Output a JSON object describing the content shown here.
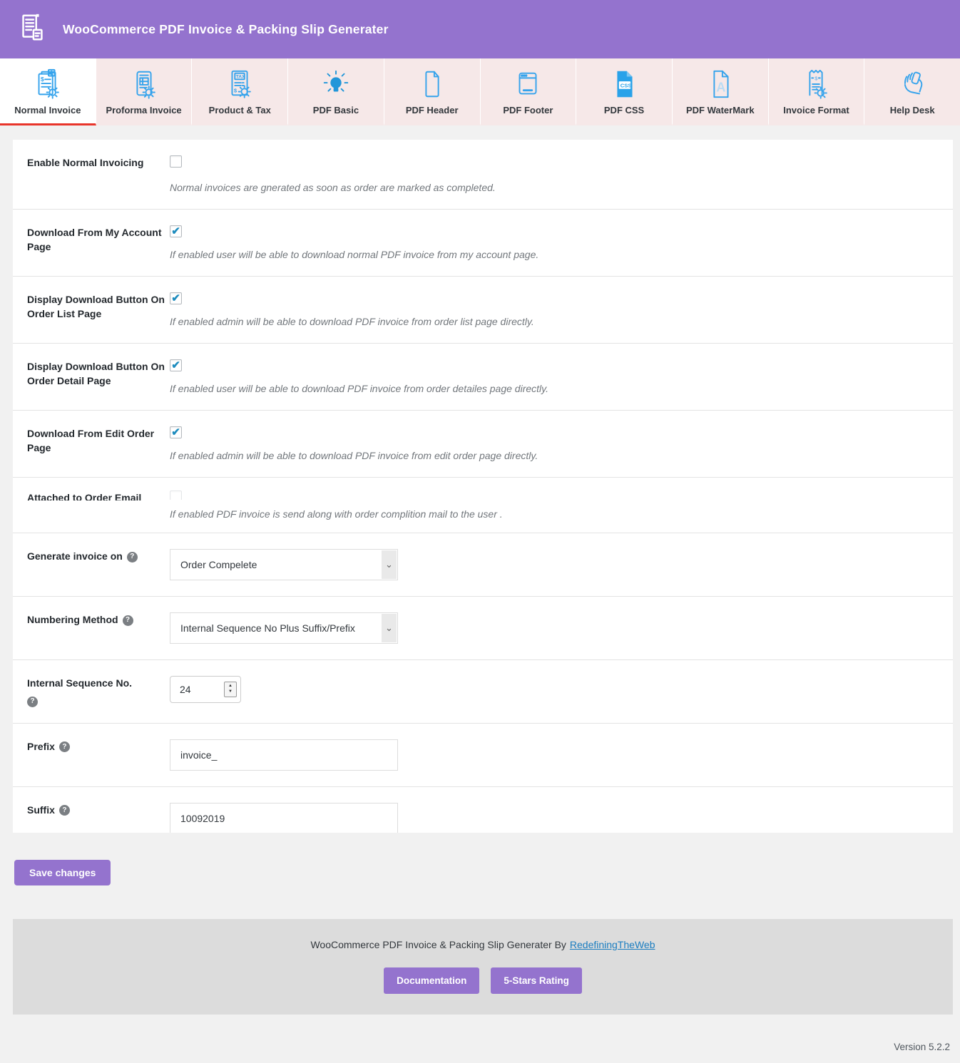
{
  "header": {
    "title": "WooCommerce PDF Invoice & Packing Slip Generater"
  },
  "tabs": [
    {
      "label": "Normal Invoice",
      "active": true
    },
    {
      "label": "Proforma Invoice",
      "active": false
    },
    {
      "label": "Product & Tax",
      "active": false
    },
    {
      "label": "PDF Basic",
      "active": false
    },
    {
      "label": "PDF Header",
      "active": false
    },
    {
      "label": "PDF Footer",
      "active": false
    },
    {
      "label": "PDF CSS",
      "active": false
    },
    {
      "label": "PDF WaterMark",
      "active": false
    },
    {
      "label": "Invoice Format",
      "active": false
    },
    {
      "label": "Help Desk",
      "active": false
    }
  ],
  "settings": {
    "rows": [
      {
        "label": "Enable Normal Invoicing",
        "control": "checkbox",
        "checked": false,
        "description": "Normal invoices are gnerated as soon as order are marked as completed."
      },
      {
        "label": "Download From My Account Page",
        "control": "checkbox",
        "checked": true,
        "description": "If enabled user will be able to download normal PDF invoice from my account page."
      },
      {
        "label": "Display Download Button On Order List Page",
        "control": "checkbox",
        "checked": true,
        "description": "If enabled admin will be able to download PDF invoice from order list page directly."
      },
      {
        "label": "Display Download Button On Order Detail Page",
        "control": "checkbox",
        "checked": true,
        "description": "If enabled user will be able to download PDF invoice from order detailes page directly."
      },
      {
        "label": "Download From Edit Order Page",
        "control": "checkbox",
        "checked": true,
        "description": "If enabled admin will be able to download PDF invoice from edit order page directly."
      },
      {
        "label": "Attached to Order Email",
        "control": "checkbox",
        "checked": false,
        "clipped": true,
        "description": "If enabled PDF invoice is send along with order complition mail to the user ."
      },
      {
        "label": "Generate invoice on",
        "control": "select",
        "value": "Order Compelete",
        "has_help": true
      },
      {
        "label": "Numbering Method",
        "control": "select",
        "value": "Internal Sequence No Plus Suffix/Prefix",
        "has_help": true
      },
      {
        "label": "Internal Sequence No.",
        "control": "number",
        "value": "24",
        "has_help": true
      },
      {
        "label": "Prefix",
        "control": "text",
        "value": "invoice_",
        "has_help": true
      },
      {
        "label": "Suffix",
        "control": "text",
        "value": "10092019",
        "has_help": true
      }
    ],
    "save_label": "Save changes"
  },
  "icons": {
    "help_glyph": "?",
    "checkmark": "✔",
    "select_chevron": "⌄",
    "spinner_up": "▲",
    "spinner_down": "▼"
  },
  "footer": {
    "credit_text": "WooCommerce PDF Invoice & Packing Slip Generater By",
    "credit_link": "RedefiningTheWeb",
    "doc_button": "Documentation",
    "rating_button": "5-Stars Rating"
  },
  "version": "Version 5.2.2",
  "colors": {
    "accent_purple": "#9473CE",
    "tab_pink": "#F6E8E8",
    "icon_blue": "#35A3EC",
    "active_tab_underline": "#E8352B",
    "link_blue": "#1A7DC0",
    "check_blue": "#1E8CBE",
    "footer_band": "#DCDCDC"
  }
}
